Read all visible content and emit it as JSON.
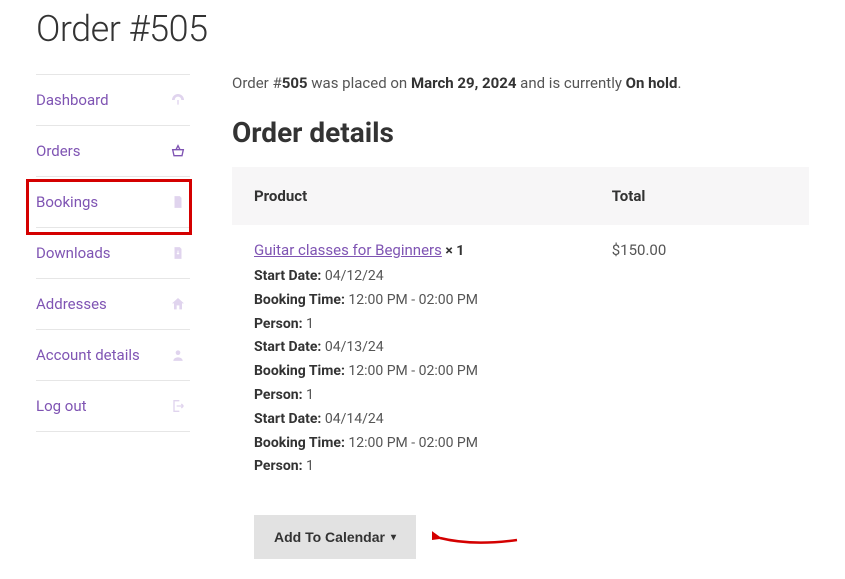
{
  "page_title": "Order #505",
  "status_line": {
    "prefix": "Order #",
    "order_no": "505",
    "mid1": " was placed on ",
    "date": "March 29, 2024",
    "mid2": " and is currently ",
    "status": "On hold",
    "suffix": "."
  },
  "section_title": "Order details",
  "sidebar": {
    "items": [
      {
        "label": "Dashboard",
        "icon": "dashboard"
      },
      {
        "label": "Orders",
        "icon": "basket"
      },
      {
        "label": "Bookings",
        "icon": "doc"
      },
      {
        "label": "Downloads",
        "icon": "download"
      },
      {
        "label": "Addresses",
        "icon": "home"
      },
      {
        "label": "Account details",
        "icon": "user"
      },
      {
        "label": "Log out",
        "icon": "logout"
      }
    ]
  },
  "table": {
    "head_product": "Product",
    "head_total": "Total",
    "product_name": "Guitar classes for Beginners",
    "qty": "× 1",
    "price": "$150.00",
    "meta": [
      {
        "label": "Start Date:",
        "value": " 04/12/24"
      },
      {
        "label": "Booking Time:",
        "value": " 12:00 PM - 02:00 PM"
      },
      {
        "label": "Person:",
        "value": " 1"
      },
      {
        "label": "Start Date:",
        "value": " 04/13/24"
      },
      {
        "label": "Booking Time:",
        "value": " 12:00 PM - 02:00 PM"
      },
      {
        "label": "Person:",
        "value": " 1"
      },
      {
        "label": "Start Date:",
        "value": " 04/14/24"
      },
      {
        "label": "Booking Time:",
        "value": " 12:00 PM - 02:00 PM"
      },
      {
        "label": "Person:",
        "value": " 1"
      }
    ],
    "add_to_calendar": "Add To Calendar"
  }
}
